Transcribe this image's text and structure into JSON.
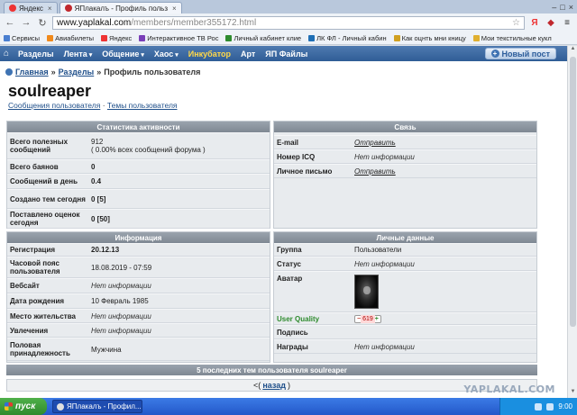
{
  "browser": {
    "tabs": [
      {
        "label": "Яндекс",
        "active": false
      },
      {
        "label": "ЯПлакалъ - Профиль польз",
        "active": true
      }
    ],
    "url_host": "www.yaplakal.com",
    "url_path": "/members/member355172.html",
    "bookmarks": [
      "Сервисы",
      "Авиабилеты",
      "Яндекс",
      "Интерактивное ТВ Рос",
      "Личный кабинет клие",
      "ЛК ФЛ - Личный кабин",
      "Как оцнть мни кницу",
      "Мои текстильные кукл"
    ]
  },
  "site_nav": {
    "items": [
      {
        "label": "Разделы",
        "dropdown": false
      },
      {
        "label": "Лента",
        "dropdown": true
      },
      {
        "label": "Общение",
        "dropdown": true
      },
      {
        "label": "Хаос",
        "dropdown": true
      },
      {
        "label": "Инкубатор",
        "dropdown": false
      },
      {
        "label": "Арт",
        "dropdown": false
      },
      {
        "label": "ЯП Файлы",
        "dropdown": false
      }
    ],
    "new_post": "Новый пост"
  },
  "breadcrumb": {
    "home": "Главная",
    "sep": "»",
    "sections": "Разделы",
    "current": "Профиль пользователя"
  },
  "profile": {
    "username": "soulreaper",
    "link_messages": "Сообщения пользователя",
    "link_sep": "·",
    "link_topics": "Темы пользователя"
  },
  "stats": {
    "title": "Статистика активности",
    "rows": [
      {
        "k": "Всего полезных сообщений",
        "v": "912",
        "sub": "( 0.00% всех сообщений форума )"
      },
      {
        "k": "Всего баянов",
        "v": "0"
      },
      {
        "k": "Сообщений в день",
        "v": "0.4"
      },
      {
        "k": "Создано тем сегодня",
        "v": "0 [5]"
      },
      {
        "k": "Поставлено оценок сегодня",
        "v": "0 [50]"
      }
    ]
  },
  "contact": {
    "title": "Связь",
    "rows": [
      {
        "k": "E-mail",
        "v": "Отправить",
        "link": true
      },
      {
        "k": "Номер ICQ",
        "v": "Нет информации"
      },
      {
        "k": "Личное письмо",
        "v": "Отправить",
        "link": true
      }
    ]
  },
  "info": {
    "title": "Информация",
    "rows": [
      {
        "k": "Регистрация",
        "v": "20.12.13",
        "style": "b"
      },
      {
        "k": "Часовой пояс пользователя",
        "v": "18.08.2019 - 07:59"
      },
      {
        "k": "Вебсайт",
        "v": "Нет информации",
        "style": "i"
      },
      {
        "k": "Дата рождения",
        "v": "10 Февраль 1985"
      },
      {
        "k": "Место жительства",
        "v": "Нет информации",
        "style": "i"
      },
      {
        "k": "Увлечения",
        "v": "Нет информации",
        "style": "i"
      },
      {
        "k": "Половая принадлежность",
        "v": "Мужчина"
      }
    ]
  },
  "personal": {
    "title": "Личные данные",
    "group_k": "Группа",
    "group_v": "Пользователи",
    "status_k": "Статус",
    "status_v": "Нет информации",
    "avatar_k": "Аватар",
    "uq_k": "User Quality",
    "uq_minus": "−",
    "uq_value": "619",
    "uq_plus": "+",
    "signature_k": "Подпись",
    "awards_k": "Награды",
    "awards_v": "Нет информации"
  },
  "last_topics": "5 последних тем пользователя soulreaper",
  "pager": {
    "prefix": "<(",
    "back": "назад",
    "suffix": ")"
  },
  "watermark": "YAPLAKAL.COM",
  "taskbar": {
    "start": "пуск",
    "task": "ЯПлакалъ - Профил...",
    "clock": "9:00"
  },
  "colors": {
    "nav": "#2f5d96",
    "panel_header": "#8a939d",
    "panel_bg": "#e8ebee",
    "incubator": "#ffd84a"
  }
}
